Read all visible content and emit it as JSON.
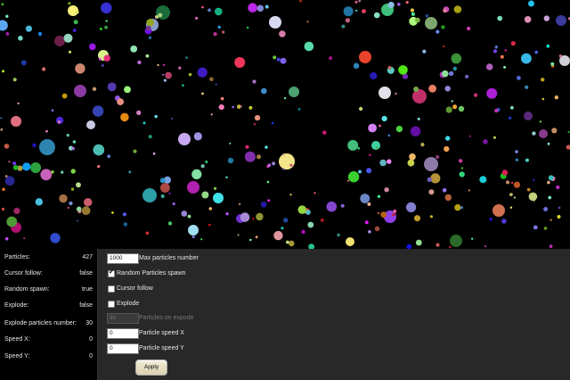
{
  "stats": {
    "particles_label": "Particles:",
    "particles_value": "427",
    "cursor_follow_label": "Cursor follow:",
    "cursor_follow_value": "false",
    "random_spawn_label": "Random spawn:",
    "random_spawn_value": "true",
    "explode_label": "Explode:",
    "explode_value": "false",
    "explode_particles_label": "Explode particles number:",
    "explode_particles_value": "30",
    "speed_x_label": "Speed X:",
    "speed_x_value": "0",
    "speed_y_label": "Speed Y:",
    "speed_y_value": "0"
  },
  "controls": {
    "max_particles_value": "1000",
    "max_particles_label": "Max particles number",
    "random_spawn_label": "Random Particles spawn",
    "random_spawn_checked": true,
    "cursor_follow_label": "Cursor follow",
    "cursor_follow_checked": false,
    "explode_label": "Explode",
    "explode_checked": false,
    "particles_on_explode_value": "30",
    "particles_on_explode_label": "Particles on expode",
    "speed_x_value": "0",
    "speed_x_label": "Particle speed X",
    "speed_y_value": "0",
    "speed_y_label": "Particle speed Y",
    "apply_label": "Apply",
    "checkmark": "✔"
  }
}
